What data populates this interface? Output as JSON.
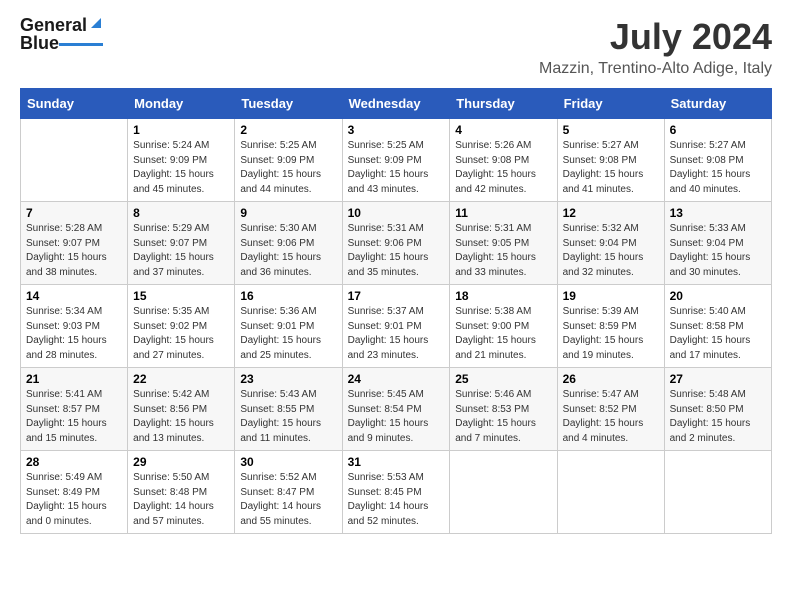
{
  "logo": {
    "line1": "General",
    "line2": "Blue"
  },
  "title": "July 2024",
  "subtitle": "Mazzin, Trentino-Alto Adige, Italy",
  "days_of_week": [
    "Sunday",
    "Monday",
    "Tuesday",
    "Wednesday",
    "Thursday",
    "Friday",
    "Saturday"
  ],
  "weeks": [
    [
      {
        "day": "",
        "info": ""
      },
      {
        "day": "1",
        "info": "Sunrise: 5:24 AM\nSunset: 9:09 PM\nDaylight: 15 hours\nand 45 minutes."
      },
      {
        "day": "2",
        "info": "Sunrise: 5:25 AM\nSunset: 9:09 PM\nDaylight: 15 hours\nand 44 minutes."
      },
      {
        "day": "3",
        "info": "Sunrise: 5:25 AM\nSunset: 9:09 PM\nDaylight: 15 hours\nand 43 minutes."
      },
      {
        "day": "4",
        "info": "Sunrise: 5:26 AM\nSunset: 9:08 PM\nDaylight: 15 hours\nand 42 minutes."
      },
      {
        "day": "5",
        "info": "Sunrise: 5:27 AM\nSunset: 9:08 PM\nDaylight: 15 hours\nand 41 minutes."
      },
      {
        "day": "6",
        "info": "Sunrise: 5:27 AM\nSunset: 9:08 PM\nDaylight: 15 hours\nand 40 minutes."
      }
    ],
    [
      {
        "day": "7",
        "info": "Sunrise: 5:28 AM\nSunset: 9:07 PM\nDaylight: 15 hours\nand 38 minutes."
      },
      {
        "day": "8",
        "info": "Sunrise: 5:29 AM\nSunset: 9:07 PM\nDaylight: 15 hours\nand 37 minutes."
      },
      {
        "day": "9",
        "info": "Sunrise: 5:30 AM\nSunset: 9:06 PM\nDaylight: 15 hours\nand 36 minutes."
      },
      {
        "day": "10",
        "info": "Sunrise: 5:31 AM\nSunset: 9:06 PM\nDaylight: 15 hours\nand 35 minutes."
      },
      {
        "day": "11",
        "info": "Sunrise: 5:31 AM\nSunset: 9:05 PM\nDaylight: 15 hours\nand 33 minutes."
      },
      {
        "day": "12",
        "info": "Sunrise: 5:32 AM\nSunset: 9:04 PM\nDaylight: 15 hours\nand 32 minutes."
      },
      {
        "day": "13",
        "info": "Sunrise: 5:33 AM\nSunset: 9:04 PM\nDaylight: 15 hours\nand 30 minutes."
      }
    ],
    [
      {
        "day": "14",
        "info": "Sunrise: 5:34 AM\nSunset: 9:03 PM\nDaylight: 15 hours\nand 28 minutes."
      },
      {
        "day": "15",
        "info": "Sunrise: 5:35 AM\nSunset: 9:02 PM\nDaylight: 15 hours\nand 27 minutes."
      },
      {
        "day": "16",
        "info": "Sunrise: 5:36 AM\nSunset: 9:01 PM\nDaylight: 15 hours\nand 25 minutes."
      },
      {
        "day": "17",
        "info": "Sunrise: 5:37 AM\nSunset: 9:01 PM\nDaylight: 15 hours\nand 23 minutes."
      },
      {
        "day": "18",
        "info": "Sunrise: 5:38 AM\nSunset: 9:00 PM\nDaylight: 15 hours\nand 21 minutes."
      },
      {
        "day": "19",
        "info": "Sunrise: 5:39 AM\nSunset: 8:59 PM\nDaylight: 15 hours\nand 19 minutes."
      },
      {
        "day": "20",
        "info": "Sunrise: 5:40 AM\nSunset: 8:58 PM\nDaylight: 15 hours\nand 17 minutes."
      }
    ],
    [
      {
        "day": "21",
        "info": "Sunrise: 5:41 AM\nSunset: 8:57 PM\nDaylight: 15 hours\nand 15 minutes."
      },
      {
        "day": "22",
        "info": "Sunrise: 5:42 AM\nSunset: 8:56 PM\nDaylight: 15 hours\nand 13 minutes."
      },
      {
        "day": "23",
        "info": "Sunrise: 5:43 AM\nSunset: 8:55 PM\nDaylight: 15 hours\nand 11 minutes."
      },
      {
        "day": "24",
        "info": "Sunrise: 5:45 AM\nSunset: 8:54 PM\nDaylight: 15 hours\nand 9 minutes."
      },
      {
        "day": "25",
        "info": "Sunrise: 5:46 AM\nSunset: 8:53 PM\nDaylight: 15 hours\nand 7 minutes."
      },
      {
        "day": "26",
        "info": "Sunrise: 5:47 AM\nSunset: 8:52 PM\nDaylight: 15 hours\nand 4 minutes."
      },
      {
        "day": "27",
        "info": "Sunrise: 5:48 AM\nSunset: 8:50 PM\nDaylight: 15 hours\nand 2 minutes."
      }
    ],
    [
      {
        "day": "28",
        "info": "Sunrise: 5:49 AM\nSunset: 8:49 PM\nDaylight: 15 hours\nand 0 minutes."
      },
      {
        "day": "29",
        "info": "Sunrise: 5:50 AM\nSunset: 8:48 PM\nDaylight: 14 hours\nand 57 minutes."
      },
      {
        "day": "30",
        "info": "Sunrise: 5:52 AM\nSunset: 8:47 PM\nDaylight: 14 hours\nand 55 minutes."
      },
      {
        "day": "31",
        "info": "Sunrise: 5:53 AM\nSunset: 8:45 PM\nDaylight: 14 hours\nand 52 minutes."
      },
      {
        "day": "",
        "info": ""
      },
      {
        "day": "",
        "info": ""
      },
      {
        "day": "",
        "info": ""
      }
    ]
  ]
}
